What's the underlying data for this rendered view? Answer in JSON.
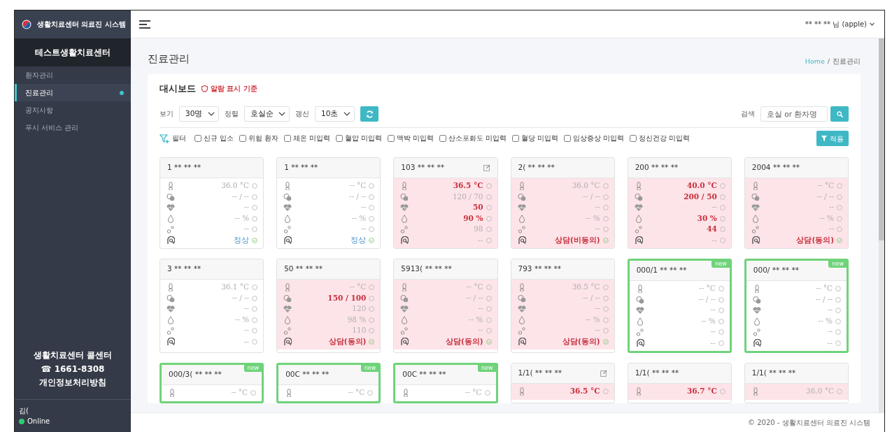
{
  "brand": {
    "title": "생활치료센터 의료진 시스템"
  },
  "sidebar": {
    "center_name": "테스트생활치료센터",
    "items": [
      {
        "label": "환자관리",
        "selected": false
      },
      {
        "label": "진료관리",
        "selected": true
      },
      {
        "label": "공지사항",
        "selected": false
      },
      {
        "label": "푸시 서비스 관리",
        "selected": false
      }
    ],
    "callcenter": {
      "title": "생활치료센터 콜센터",
      "phone": "☎ 1661-8308",
      "privacy": "개인정보처리방침"
    },
    "user": {
      "name": "김(",
      "status": "Online"
    }
  },
  "header": {
    "user": "** ** ** 님 (apple)"
  },
  "page": {
    "title": "진료관리",
    "breadcrumb": {
      "items": [
        "Home",
        "진료관리"
      ],
      "separator": "/"
    }
  },
  "dashboard": {
    "title": "대시보드",
    "alarm_link": "알람 표시 기준",
    "controls": [
      {
        "label": "보기",
        "value": "30명"
      },
      {
        "label": "정렬",
        "value": "호실순"
      },
      {
        "label": "갱신",
        "value": "10초"
      }
    ],
    "search": {
      "label": "검색",
      "placeholder": "호실 or 환자명"
    },
    "filters": {
      "label": "필터",
      "apply": "적용",
      "items": [
        {
          "label": "신규 입소",
          "checked": false
        },
        {
          "label": "위험 환자",
          "checked": false
        },
        {
          "label": "체온 미입력",
          "checked": false
        },
        {
          "label": "혈압 미입력",
          "checked": false
        },
        {
          "label": "맥박 미입력",
          "checked": false
        },
        {
          "label": "산소포화도 미입력",
          "checked": false
        },
        {
          "label": "혈당 미입력",
          "checked": false
        },
        {
          "label": "임상증상 미입력",
          "checked": false
        },
        {
          "label": "정신건강 미입력",
          "checked": false
        }
      ]
    }
  },
  "cards": [
    {
      "room": "1 ** ** **",
      "alert": false,
      "is_new": false,
      "edit": false,
      "rows": [
        {
          "kind": "temp",
          "value": "36.0 °C",
          "color": "#b0b0b0",
          "bold": false,
          "checked": false
        },
        {
          "kind": "bp",
          "value": "-- / --",
          "color": "#b0b0b0",
          "bold": false,
          "checked": false
        },
        {
          "kind": "pulse",
          "value": "--",
          "color": "#b0b0b0",
          "bold": false,
          "checked": false
        },
        {
          "kind": "spo2",
          "value": "-- %",
          "color": "#b0b0b0",
          "bold": false,
          "checked": false
        },
        {
          "kind": "glucose",
          "value": "--",
          "color": "#b0b0b0",
          "bold": false,
          "checked": false
        },
        {
          "kind": "symptom",
          "value": "정상",
          "color": "#4f95c9",
          "bold": false,
          "checked": true
        }
      ]
    },
    {
      "room": "1 ** ** **",
      "alert": false,
      "is_new": false,
      "edit": false,
      "rows": [
        {
          "kind": "temp",
          "value": "-- °C",
          "color": "#b0b0b0",
          "bold": false,
          "checked": false
        },
        {
          "kind": "bp",
          "value": "-- / --",
          "color": "#b0b0b0",
          "bold": false,
          "checked": false
        },
        {
          "kind": "pulse",
          "value": "--",
          "color": "#b0b0b0",
          "bold": false,
          "checked": false
        },
        {
          "kind": "spo2",
          "value": "-- %",
          "color": "#b0b0b0",
          "bold": false,
          "checked": false
        },
        {
          "kind": "glucose",
          "value": "--",
          "color": "#b0b0b0",
          "bold": false,
          "checked": false
        },
        {
          "kind": "symptom",
          "value": "정상",
          "color": "#4f95c9",
          "bold": false,
          "checked": true
        }
      ]
    },
    {
      "room": "103 ** ** **",
      "alert": true,
      "is_new": false,
      "edit": true,
      "rows": [
        {
          "kind": "temp",
          "value": "36.5 °C",
          "color": "#c7303c",
          "bold": true,
          "checked": false
        },
        {
          "kind": "bp",
          "value": "120 / 70",
          "color": "#b0b0b0",
          "bold": false,
          "checked": false
        },
        {
          "kind": "pulse",
          "value": "50",
          "color": "#c7303c",
          "bold": true,
          "checked": false
        },
        {
          "kind": "spo2",
          "value": "90 %",
          "color": "#c7303c",
          "bold": true,
          "checked": false
        },
        {
          "kind": "glucose",
          "value": "98",
          "color": "#b0b0b0",
          "bold": false,
          "checked": false
        },
        {
          "kind": "symptom",
          "value": "--",
          "color": "#b0b0b0",
          "bold": false,
          "checked": false
        }
      ]
    },
    {
      "room": "2( ** ** **",
      "alert": true,
      "is_new": false,
      "edit": false,
      "rows": [
        {
          "kind": "temp",
          "value": "36.0 °C",
          "color": "#b0b0b0",
          "bold": false,
          "checked": false
        },
        {
          "kind": "bp",
          "value": "-- / --",
          "color": "#b0b0b0",
          "bold": false,
          "checked": false
        },
        {
          "kind": "pulse",
          "value": "--",
          "color": "#b0b0b0",
          "bold": false,
          "checked": false
        },
        {
          "kind": "spo2",
          "value": "-- %",
          "color": "#b0b0b0",
          "bold": false,
          "checked": false
        },
        {
          "kind": "glucose",
          "value": "--",
          "color": "#b0b0b0",
          "bold": false,
          "checked": false
        },
        {
          "kind": "symptom",
          "value": "상담(비동의)",
          "color": "#c7303c",
          "bold": true,
          "checked": true
        }
      ]
    },
    {
      "room": "200 ** ** **",
      "alert": true,
      "is_new": false,
      "edit": false,
      "rows": [
        {
          "kind": "temp",
          "value": "40.0 °C",
          "color": "#c7303c",
          "bold": true,
          "checked": false
        },
        {
          "kind": "bp",
          "value": "200 / 50",
          "color": "#c7303c",
          "bold": true,
          "checked": false
        },
        {
          "kind": "pulse",
          "value": "--",
          "color": "#b0b0b0",
          "bold": false,
          "checked": false
        },
        {
          "kind": "spo2",
          "value": "30 %",
          "color": "#c7303c",
          "bold": true,
          "checked": false
        },
        {
          "kind": "glucose",
          "value": "44",
          "color": "#c7303c",
          "bold": true,
          "checked": false
        },
        {
          "kind": "symptom",
          "value": "--",
          "color": "#b0b0b0",
          "bold": false,
          "checked": false
        }
      ]
    },
    {
      "room": "2004 ** ** **",
      "alert": true,
      "is_new": false,
      "edit": false,
      "rows": [
        {
          "kind": "temp",
          "value": "-- °C",
          "color": "#b0b0b0",
          "bold": false,
          "checked": false
        },
        {
          "kind": "bp",
          "value": "-- / --",
          "color": "#b0b0b0",
          "bold": false,
          "checked": false
        },
        {
          "kind": "pulse",
          "value": "--",
          "color": "#b0b0b0",
          "bold": false,
          "checked": false
        },
        {
          "kind": "spo2",
          "value": "-- %",
          "color": "#b0b0b0",
          "bold": false,
          "checked": false
        },
        {
          "kind": "glucose",
          "value": "--",
          "color": "#b0b0b0",
          "bold": false,
          "checked": false
        },
        {
          "kind": "symptom",
          "value": "상담(동의)",
          "color": "#c7303c",
          "bold": true,
          "checked": true
        }
      ]
    },
    {
      "room": "3 ** ** **",
      "alert": false,
      "is_new": false,
      "edit": false,
      "rows": [
        {
          "kind": "temp",
          "value": "36.1 °C",
          "color": "#b0b0b0",
          "bold": false,
          "checked": false
        },
        {
          "kind": "bp",
          "value": "-- / --",
          "color": "#b0b0b0",
          "bold": false,
          "checked": false
        },
        {
          "kind": "pulse",
          "value": "--",
          "color": "#b0b0b0",
          "bold": false,
          "checked": false
        },
        {
          "kind": "spo2",
          "value": "-- %",
          "color": "#b0b0b0",
          "bold": false,
          "checked": false
        },
        {
          "kind": "glucose",
          "value": "--",
          "color": "#b0b0b0",
          "bold": false,
          "checked": false
        },
        {
          "kind": "symptom",
          "value": "--",
          "color": "#b0b0b0",
          "bold": false,
          "checked": false
        }
      ]
    },
    {
      "room": "50 ** ** **",
      "alert": true,
      "is_new": false,
      "edit": false,
      "rows": [
        {
          "kind": "temp",
          "value": "-- °C",
          "color": "#b0b0b0",
          "bold": false,
          "checked": false
        },
        {
          "kind": "bp",
          "value": "150 / 100",
          "color": "#c7303c",
          "bold": true,
          "checked": false
        },
        {
          "kind": "pulse",
          "value": "120",
          "color": "#b0b0b0",
          "bold": false,
          "checked": false
        },
        {
          "kind": "spo2",
          "value": "98 %",
          "color": "#b0b0b0",
          "bold": false,
          "checked": false
        },
        {
          "kind": "glucose",
          "value": "110",
          "color": "#b0b0b0",
          "bold": false,
          "checked": false
        },
        {
          "kind": "symptom",
          "value": "상담(동의)",
          "color": "#c7303c",
          "bold": true,
          "checked": true
        }
      ]
    },
    {
      "room": "5913( ** ** **",
      "alert": true,
      "is_new": false,
      "edit": false,
      "rows": [
        {
          "kind": "temp",
          "value": "-- °C",
          "color": "#b0b0b0",
          "bold": false,
          "checked": false
        },
        {
          "kind": "bp",
          "value": "-- / --",
          "color": "#b0b0b0",
          "bold": false,
          "checked": false
        },
        {
          "kind": "pulse",
          "value": "--",
          "color": "#b0b0b0",
          "bold": false,
          "checked": false
        },
        {
          "kind": "spo2",
          "value": "-- %",
          "color": "#b0b0b0",
          "bold": false,
          "checked": false
        },
        {
          "kind": "glucose",
          "value": "--",
          "color": "#b0b0b0",
          "bold": false,
          "checked": false
        },
        {
          "kind": "symptom",
          "value": "상담(동의)",
          "color": "#c7303c",
          "bold": true,
          "checked": true
        }
      ]
    },
    {
      "room": "793 ** ** **",
      "alert": true,
      "is_new": false,
      "edit": false,
      "rows": [
        {
          "kind": "temp",
          "value": "36.5 °C",
          "color": "#b0b0b0",
          "bold": false,
          "checked": false
        },
        {
          "kind": "bp",
          "value": "-- / --",
          "color": "#b0b0b0",
          "bold": false,
          "checked": false
        },
        {
          "kind": "pulse",
          "value": "--",
          "color": "#b0b0b0",
          "bold": false,
          "checked": false
        },
        {
          "kind": "spo2",
          "value": "-- %",
          "color": "#b0b0b0",
          "bold": false,
          "checked": false
        },
        {
          "kind": "glucose",
          "value": "--",
          "color": "#b0b0b0",
          "bold": false,
          "checked": false
        },
        {
          "kind": "symptom",
          "value": "상담(동의)",
          "color": "#c7303c",
          "bold": true,
          "checked": true
        }
      ]
    },
    {
      "room": "000/1 ** ** **",
      "alert": false,
      "is_new": true,
      "badge": "new",
      "edit": false,
      "rows": [
        {
          "kind": "temp",
          "value": "-- °C",
          "color": "#b0b0b0",
          "bold": false,
          "checked": false
        },
        {
          "kind": "bp",
          "value": "-- / --",
          "color": "#b0b0b0",
          "bold": false,
          "checked": false
        },
        {
          "kind": "pulse",
          "value": "--",
          "color": "#b0b0b0",
          "bold": false,
          "checked": false
        },
        {
          "kind": "spo2",
          "value": "-- %",
          "color": "#b0b0b0",
          "bold": false,
          "checked": false
        },
        {
          "kind": "glucose",
          "value": "--",
          "color": "#b0b0b0",
          "bold": false,
          "checked": false
        },
        {
          "kind": "symptom",
          "value": "--",
          "color": "#b0b0b0",
          "bold": false,
          "checked": false
        }
      ]
    },
    {
      "room": "000/ ** ** **",
      "alert": false,
      "is_new": true,
      "badge": "new",
      "edit": false,
      "rows": [
        {
          "kind": "temp",
          "value": "-- °C",
          "color": "#b0b0b0",
          "bold": false,
          "checked": false
        },
        {
          "kind": "bp",
          "value": "-- / --",
          "color": "#b0b0b0",
          "bold": false,
          "checked": false
        },
        {
          "kind": "pulse",
          "value": "--",
          "color": "#b0b0b0",
          "bold": false,
          "checked": false
        },
        {
          "kind": "spo2",
          "value": "-- %",
          "color": "#b0b0b0",
          "bold": false,
          "checked": false
        },
        {
          "kind": "glucose",
          "value": "--",
          "color": "#b0b0b0",
          "bold": false,
          "checked": false
        },
        {
          "kind": "symptom",
          "value": "--",
          "color": "#b0b0b0",
          "bold": false,
          "checked": false
        }
      ]
    },
    {
      "room": "000/3( ** ** **",
      "alert": false,
      "is_new": true,
      "badge": "new",
      "edit": false,
      "rows": [
        {
          "kind": "temp",
          "value": "-- °C",
          "color": "#b0b0b0",
          "bold": false,
          "checked": false
        }
      ]
    },
    {
      "room": "00C ** ** **",
      "alert": false,
      "is_new": true,
      "badge": "new",
      "edit": false,
      "rows": [
        {
          "kind": "temp",
          "value": "-- °C",
          "color": "#b0b0b0",
          "bold": false,
          "checked": false
        }
      ]
    },
    {
      "room": "00C ** ** **",
      "alert": false,
      "is_new": true,
      "badge": "new",
      "edit": false,
      "rows": [
        {
          "kind": "temp",
          "value": "-- °C",
          "color": "#b0b0b0",
          "bold": false,
          "checked": false
        }
      ]
    },
    {
      "room": "1/1( ** ** **",
      "alert": true,
      "is_new": false,
      "edit": true,
      "rows": [
        {
          "kind": "temp",
          "value": "36.5 °C",
          "color": "#c7303c",
          "bold": true,
          "checked": false
        }
      ]
    },
    {
      "room": "1/1( ** ** **",
      "alert": true,
      "is_new": false,
      "edit": false,
      "rows": [
        {
          "kind": "temp",
          "value": "36.7 °C",
          "color": "#c7303c",
          "bold": true,
          "checked": false
        }
      ]
    },
    {
      "room": "1/1( ** ** **",
      "alert": true,
      "is_new": false,
      "edit": false,
      "rows": [
        {
          "kind": "temp",
          "value": "36.0 °C",
          "color": "#b0b0b0",
          "bold": false,
          "checked": false
        }
      ]
    }
  ],
  "footer": "© 2020 - 생활치료센터 의료진 시스템"
}
